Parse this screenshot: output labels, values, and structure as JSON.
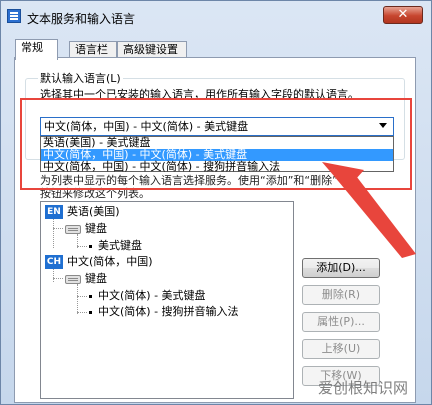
{
  "window": {
    "title": "文本服务和输入语言",
    "close_glyph": "✕"
  },
  "tabs": [
    {
      "label": "常规",
      "active": true
    },
    {
      "label": "语言栏",
      "active": false
    },
    {
      "label": "高级键设置",
      "active": false
    }
  ],
  "default_language": {
    "group_label": "默认输入语言(L)",
    "description": "选择其中一个已安装的输入语言，用作所有输入字段的默认语言。",
    "selected_value": "中文(简体，中国) - 中文(简体) - 美式键盘",
    "options": [
      {
        "label": "英语(美国) - 美式键盘",
        "selected": false
      },
      {
        "label": "中文(简体，中国) - 中文(简体) - 美式键盘",
        "selected": true
      },
      {
        "label": "中文(简体，中国) - 中文(简体) - 搜狗拼音输入法",
        "selected": false
      }
    ]
  },
  "services": {
    "partial_line_1": "为列表中显示的每个输入语言选择服务。使用“添加”和“删除”",
    "partial_line_2": "按钮来修改这个列表。",
    "partial_add": "添加",
    "partial_delete": "删除"
  },
  "tree": {
    "languages": [
      {
        "badge": "EN",
        "name": "英语(美国)",
        "category": "键盘",
        "items": [
          "美式键盘"
        ]
      },
      {
        "badge": "CH",
        "name": "中文(简体，中国)",
        "category": "键盘",
        "items": [
          "中文(简体) - 美式键盘",
          "中文(简体) - 搜狗拼音输入法"
        ]
      }
    ]
  },
  "buttons": {
    "add": "添加(D)...",
    "remove": "删除(R)",
    "properties": "属性(P)...",
    "move_up": "上移(U)",
    "move_down": "下移(W)"
  },
  "watermark": "爱创根知识网",
  "colors": {
    "selection": "#3399ff",
    "annotation": "#e8453c",
    "badge": "#1f6fd1"
  }
}
